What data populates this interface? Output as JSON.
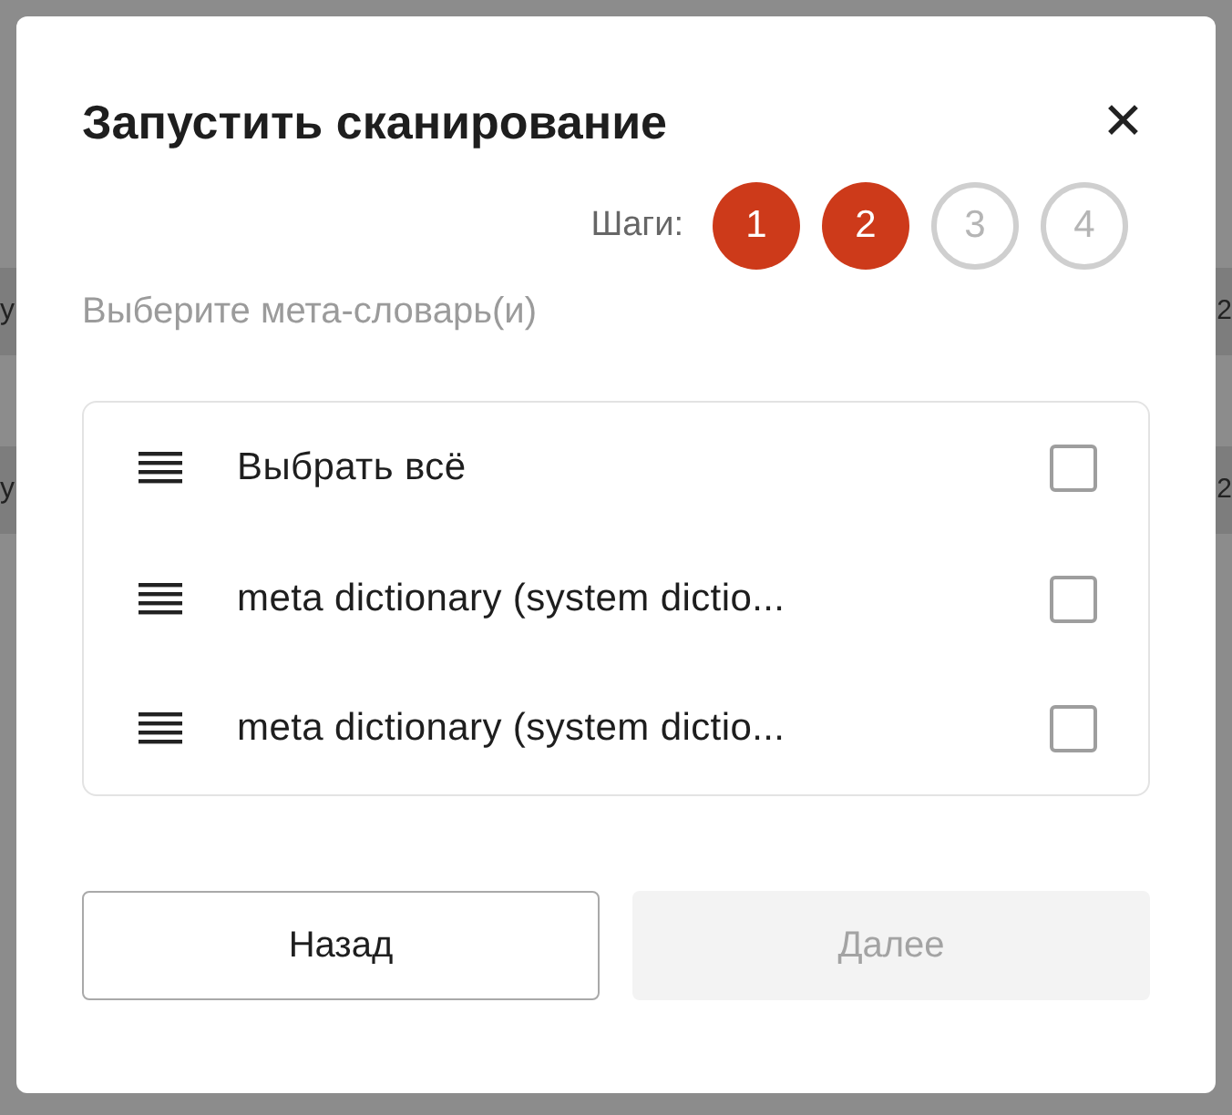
{
  "background": {
    "rows": [
      {
        "column_1": "y",
        "column_2": "2"
      },
      {
        "column_1": "y",
        "column_2": "2"
      }
    ]
  },
  "dialog": {
    "title": "Запустить сканирование",
    "close": "✕",
    "steps": {
      "label": "Шаги:",
      "items": [
        {
          "label": "1",
          "done": true
        },
        {
          "label": "2",
          "done": true
        },
        {
          "label": "3",
          "done": false
        },
        {
          "label": "4",
          "done": false
        }
      ]
    },
    "subtitle": "Выберите мета-словарь(и)",
    "items": [
      {
        "label": "Выбрать всё",
        "checked": false
      },
      {
        "label": "meta dictionary (system dictio...",
        "checked": false
      },
      {
        "label": "meta dictionary (system dictio...",
        "checked": false
      }
    ],
    "buttons": [
      {
        "label": "Назад",
        "disabled": false
      },
      {
        "label": "Далее",
        "disabled": true
      }
    ]
  }
}
